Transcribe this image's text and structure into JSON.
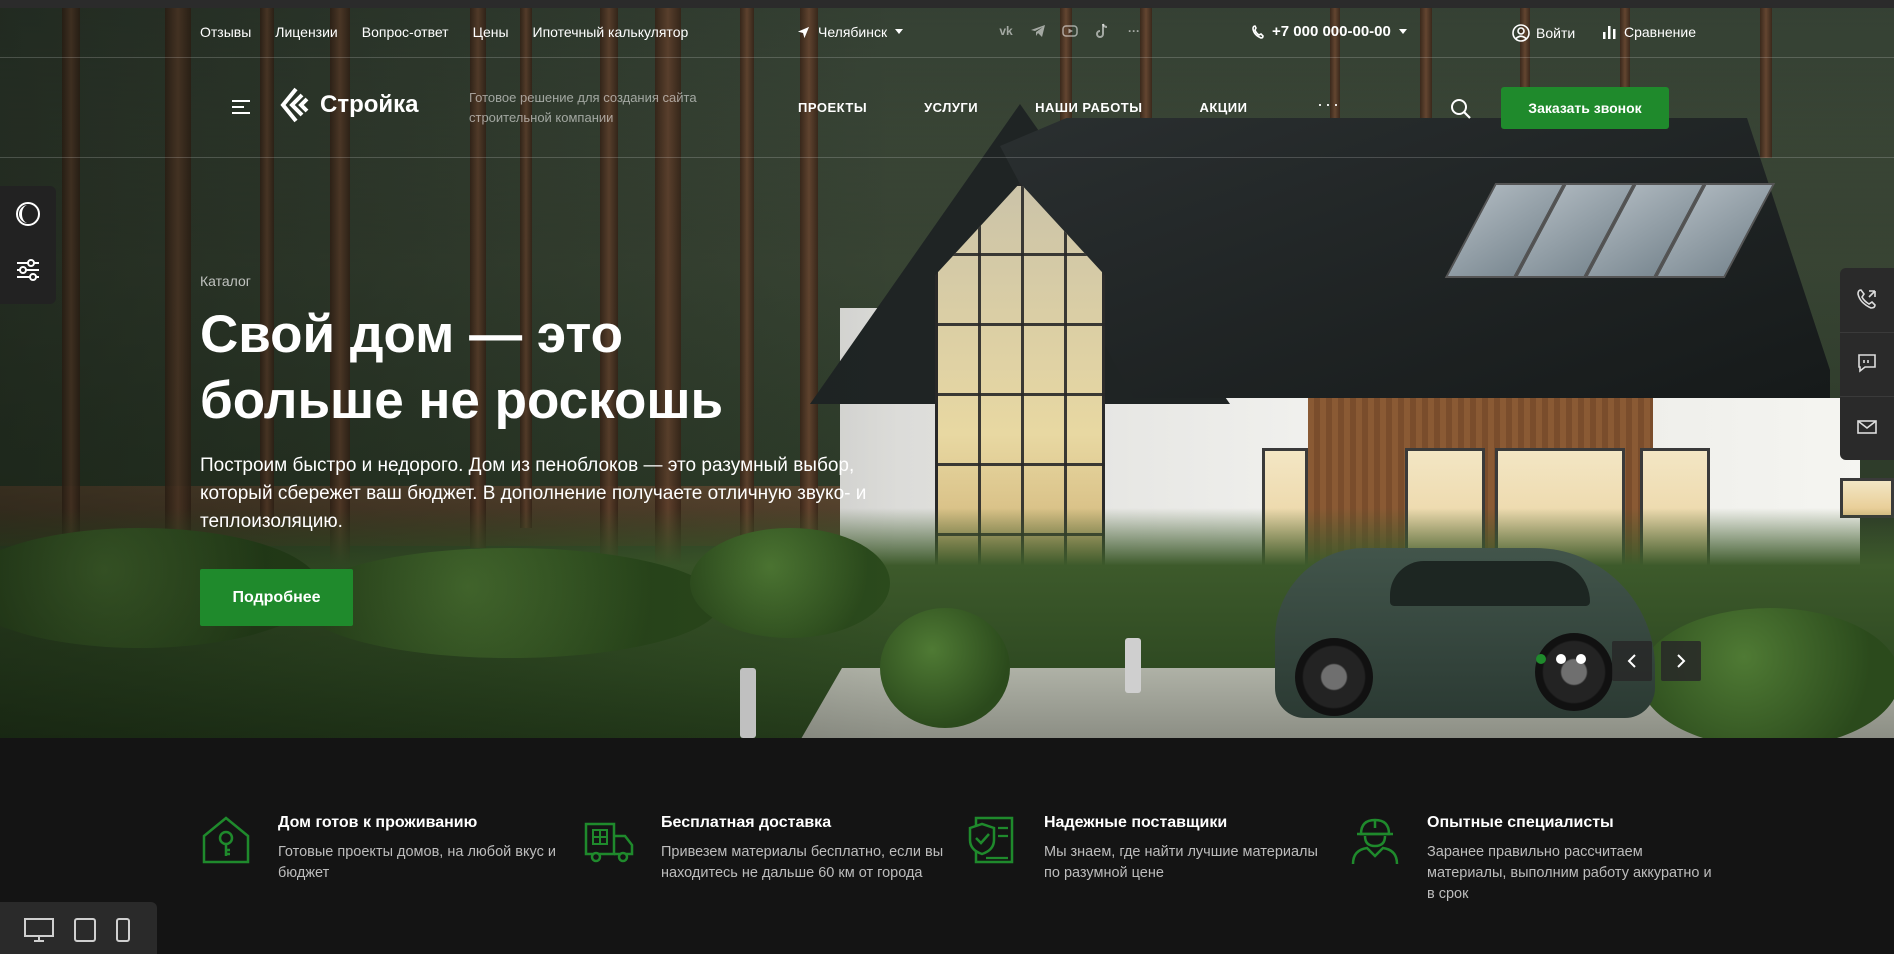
{
  "topbar": {
    "links": [
      "Отзывы",
      "Лицензии",
      "Вопрос-ответ",
      "Цены",
      "Ипотечный калькулятор"
    ],
    "city": "Челябинск",
    "socials": [
      "vk-icon",
      "telegram-icon",
      "youtube-icon",
      "tiktok-icon",
      "more-icon"
    ],
    "phone": "+7 000 000-00-00",
    "login": "Войти",
    "compare": "Сравнение"
  },
  "header": {
    "logo": "Стройка",
    "slogan": "Готовое решение для создания сайта строительной компании",
    "nav": [
      "ПРОЕКТЫ",
      "УСЛУГИ",
      "НАШИ РАБОТЫ",
      "АКЦИИ"
    ],
    "more": "···",
    "cta": "Заказать звонок"
  },
  "hero": {
    "breadcrumb": "Каталог",
    "title": "Свой дом — это больше не роскошь",
    "text": "Построим быстро и недорого. Дом из пеноблоков — это разумный выбор, который сбережет ваш бюджет. В дополнение получаете отличную звуко- и теплоизоляцию.",
    "button": "Подробнее",
    "slides_total": 3,
    "slide_active": 1,
    "prev": "‹",
    "next": "›"
  },
  "features": [
    {
      "icon": "house-key-icon",
      "title": "Дом готов к проживанию",
      "text": "Готовые проекты домов, на любой вкус и бюджет"
    },
    {
      "icon": "delivery-truck-icon",
      "title": "Бесплатная доставка",
      "text": "Привезем материалы бесплатно, если вы находитесь не дальше 60 км от города"
    },
    {
      "icon": "shield-document-icon",
      "title": "Надежные поставщики",
      "text": "Мы знаем, где найти лучшие материалы по разумной цене"
    },
    {
      "icon": "worker-helmet-icon",
      "title": "Опытные специалисты",
      "text": "Заранее правильно рассчитаем материалы, выполним работу аккуратно и в срок"
    }
  ],
  "colors": {
    "accent": "#1f8a2c",
    "dark": "#141414"
  }
}
